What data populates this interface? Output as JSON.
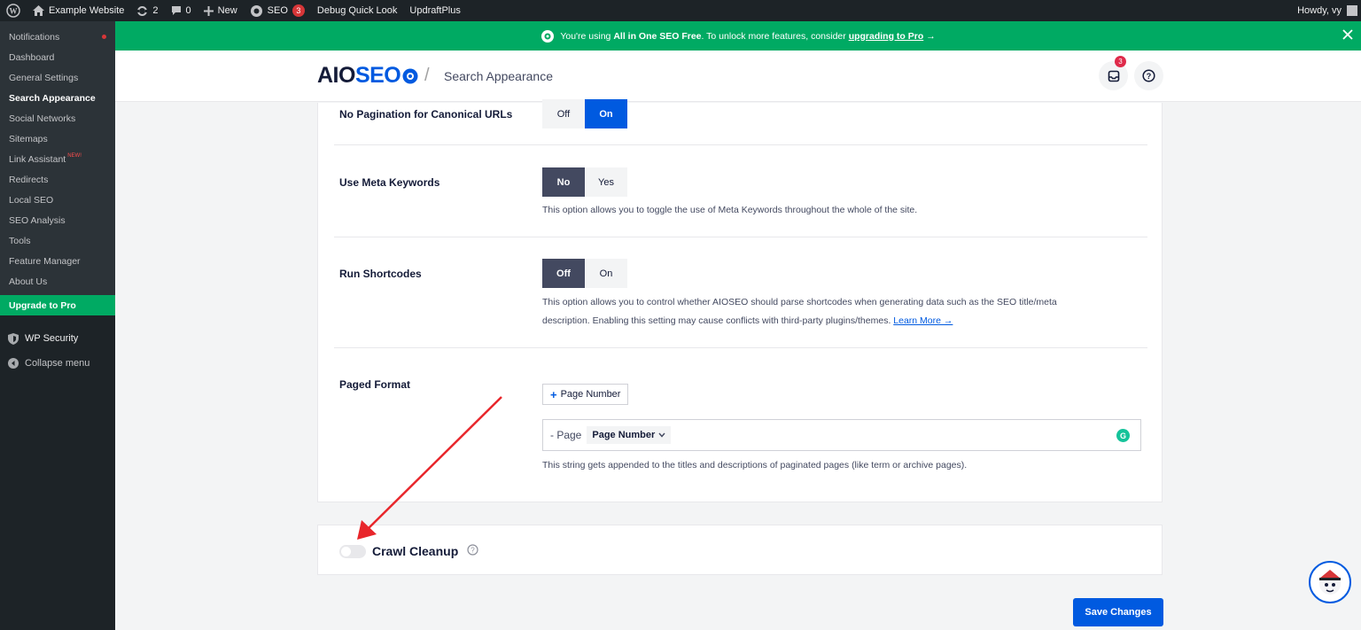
{
  "adminbar": {
    "site_name": "Example Website",
    "updates_count": "2",
    "comments_count": "0",
    "new_label": "New",
    "seo_label": "SEO",
    "seo_badge": "3",
    "debug_label": "Debug Quick Look",
    "updraft_label": "UpdraftPlus",
    "howdy": "Howdy, vy"
  },
  "sidebar": {
    "items": [
      {
        "label": "Notifications"
      },
      {
        "label": "Dashboard"
      },
      {
        "label": "General Settings"
      },
      {
        "label": "Search Appearance"
      },
      {
        "label": "Social Networks"
      },
      {
        "label": "Sitemaps"
      },
      {
        "label": "Link Assistant",
        "badge": "NEW!"
      },
      {
        "label": "Redirects"
      },
      {
        "label": "Local SEO"
      },
      {
        "label": "SEO Analysis"
      },
      {
        "label": "Tools"
      },
      {
        "label": "Feature Manager"
      },
      {
        "label": "About Us"
      }
    ],
    "upgrade": "Upgrade to Pro",
    "wp_security": "WP Security",
    "collapse": "Collapse menu"
  },
  "notice": {
    "prefix": "You're using",
    "product": "All in One SEO Free",
    "middle": ". To unlock more features, consider",
    "link": "upgrading to Pro",
    "arrow": "→"
  },
  "header": {
    "logo_aio": "AIO",
    "logo_seo": "SEO",
    "separator": "/",
    "page": "Search Appearance",
    "notifications_badge": "3"
  },
  "settings": {
    "pagination": {
      "label": "No Pagination for Canonical URLs",
      "opt1": "Off",
      "opt2": "On"
    },
    "meta_keywords": {
      "label": "Use Meta Keywords",
      "opt1": "No",
      "opt2": "Yes",
      "desc": "This option allows you to toggle the use of Meta Keywords throughout the whole of the site."
    },
    "shortcodes": {
      "label": "Run Shortcodes",
      "opt1": "Off",
      "opt2": "On",
      "desc_line1": "This option allows you to control whether AIOSEO should parse shortcodes when generating data such as the SEO title/meta",
      "desc_line2": "description. Enabling this setting may cause conflicts with third-party plugins/themes.",
      "learn_more": "Learn More →"
    },
    "paged_format": {
      "label": "Paged Format",
      "add_tag": "Page Number",
      "prefix_text": "- Page",
      "chip": "Page Number",
      "desc": "This string gets appended to the titles and descriptions of paginated pages (like term or archive pages)."
    }
  },
  "crawl": {
    "title": "Crawl Cleanup"
  },
  "save_label": "Save Changes",
  "colors": {
    "accent": "#005ae0",
    "green": "#00aa63",
    "dark": "#434960",
    "annotation": "#e8262b"
  }
}
